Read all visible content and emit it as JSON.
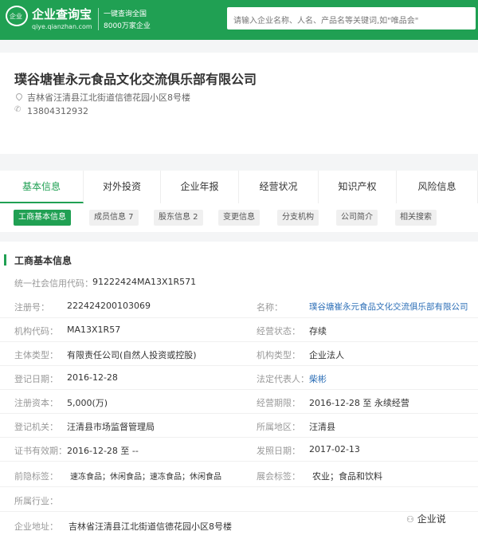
{
  "header": {
    "logo_badge": "企业",
    "logo_title": "企业查询宝",
    "logo_sub": "qiye.qianzhan.com",
    "slogan_line1": "一键查询全国",
    "slogan_line2": "8000万家企业",
    "search_placeholder": "请输入企业名称、人名、产品名等关键词,如\"唯品会\""
  },
  "company": {
    "name": "璞谷塘崔永元食品文化交流俱乐部有限公司",
    "address": "吉林省汪清县江北街道信德花园小区8号楼",
    "phone": "13804312932"
  },
  "tabs": [
    "基本信息",
    "对外投资",
    "企业年报",
    "经营状况",
    "知识产权",
    "风险信息"
  ],
  "subtabs": [
    "工商基本信息",
    "成员信息 7",
    "股东信息 2",
    "变更信息",
    "分支机构",
    "公司简介",
    "相关搜索"
  ],
  "section": {
    "title": "工商基本信息",
    "uscc_label": "统一社会信用代码：",
    "uscc_value": "91222424MA13X1R571"
  },
  "rows": [
    {
      "l1": "注册号：",
      "v1": "222424200103069",
      "l2": "名称：",
      "v2": "璞谷塘崔永元食品文化交流俱乐部有限公司"
    },
    {
      "l1": "机构代码：",
      "v1": "MA13X1R57",
      "l2": "经营状态：",
      "v2": "存续"
    },
    {
      "l1": "主体类型：",
      "v1": "有限责任公司(自然人投资或控股)",
      "l2": "机构类型：",
      "v2": "企业法人"
    },
    {
      "l1": "登记日期：",
      "v1": "2016-12-28",
      "l2": "法定代表人：",
      "v2": "柴彬"
    },
    {
      "l1": "注册资本：",
      "v1": "5,000(万)",
      "l2": "经营期限：",
      "v2": "2016-12-28 至 永续经营"
    },
    {
      "l1": "登记机关：",
      "v1": "汪清县市场监督管理局",
      "l2": "所属地区：",
      "v2": "汪清县"
    },
    {
      "l1": "证书有效期：",
      "v1": "2016-12-28 至 --",
      "l2": "发照日期：",
      "v2": "2017-02-13"
    },
    {
      "l1": "前隐标签：",
      "v1": "速冻食品；休闲食品；速冻食品；休闲食品",
      "l2": "展会标签：",
      "v2": "农业；食品和饮料"
    },
    {
      "l1": "所属行业：",
      "v1": "",
      "l2": "",
      "v2": ""
    },
    {
      "l1": "企业地址：",
      "v1": "吉林省汪清县江北街道信德花园小区8号楼",
      "l2": "",
      "v2": ""
    }
  ],
  "watermark": "企业说",
  "colors": {
    "brand": "#20a053",
    "link": "#2d6fb7"
  }
}
